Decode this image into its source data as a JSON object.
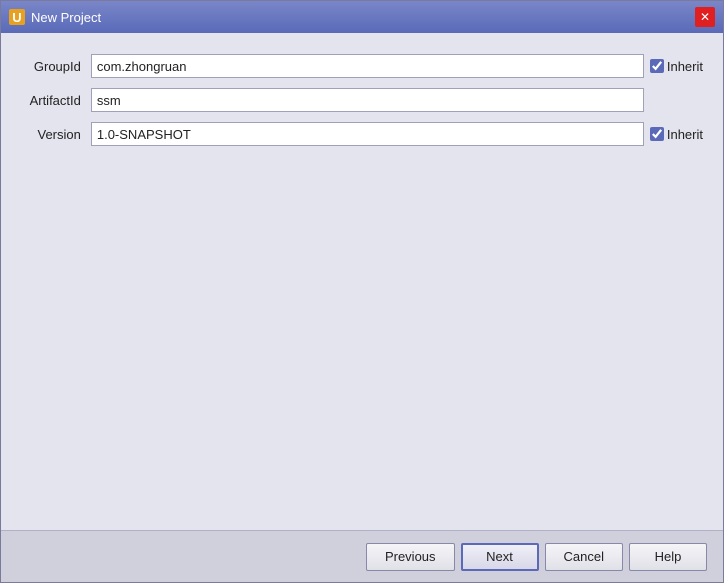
{
  "window": {
    "title": "New Project",
    "icon_label": "U"
  },
  "form": {
    "fields": [
      {
        "label": "GroupId",
        "name": "groupid",
        "value": "com.zhongruan",
        "has_inherit": true,
        "inherit_checked": true,
        "inherit_label": "Inherit"
      },
      {
        "label": "ArtifactId",
        "name": "artifactid",
        "value": "ssm",
        "has_inherit": false
      },
      {
        "label": "Version",
        "name": "version",
        "value": "1.0-SNAPSHOT",
        "has_inherit": true,
        "inherit_checked": true,
        "inherit_label": "Inherit"
      }
    ]
  },
  "footer": {
    "previous_label": "Previous",
    "next_label": "Next",
    "cancel_label": "Cancel",
    "help_label": "Help"
  }
}
